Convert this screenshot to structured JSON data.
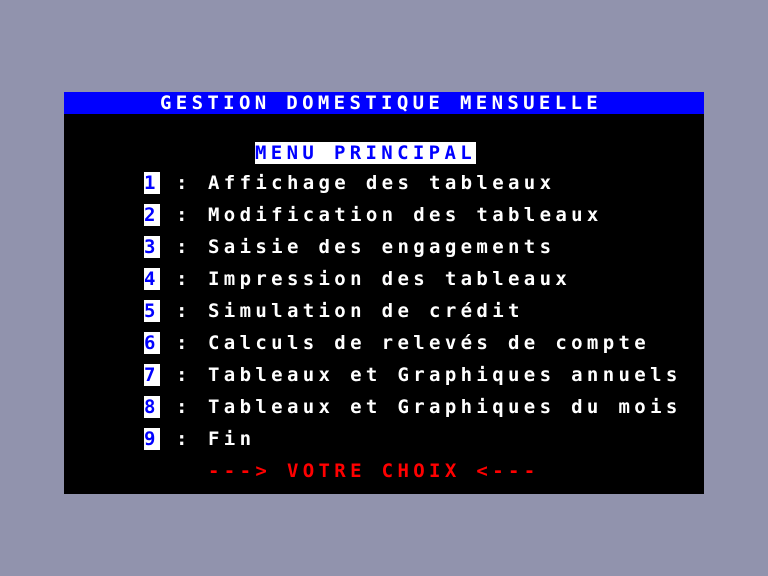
{
  "screen": {
    "title": "GESTION DOMESTIQUE MENSUELLE",
    "heading": "MENU PRINCIPAL",
    "prompt": "---> VOTRE CHOIX <---",
    "colors": {
      "desktop_background": "#9193ad",
      "screen_background": "#000000",
      "title_bar_background": "#0000ff",
      "title_text": "#ffffff",
      "heading_text": "#0000ff",
      "heading_background": "#ffffff",
      "menu_key_text": "#0000ff",
      "menu_key_background": "#ffffff",
      "menu_label_text": "#ffffff",
      "prompt_text": "#ff0000"
    },
    "separator": ":",
    "menu_items": [
      {
        "key": "1",
        "label": "Affichage des tableaux"
      },
      {
        "key": "2",
        "label": "Modification des tableaux"
      },
      {
        "key": "3",
        "label": "Saisie des engagements"
      },
      {
        "key": "4",
        "label": "Impression des tableaux"
      },
      {
        "key": "5",
        "label": "Simulation de crédit"
      },
      {
        "key": "6",
        "label": "Calculs de relevés de compte"
      },
      {
        "key": "7",
        "label": "Tableaux et Graphiques annuels"
      },
      {
        "key": "8",
        "label": "Tableaux et Graphiques du mois"
      },
      {
        "key": "9",
        "label": "Fin"
      }
    ]
  }
}
